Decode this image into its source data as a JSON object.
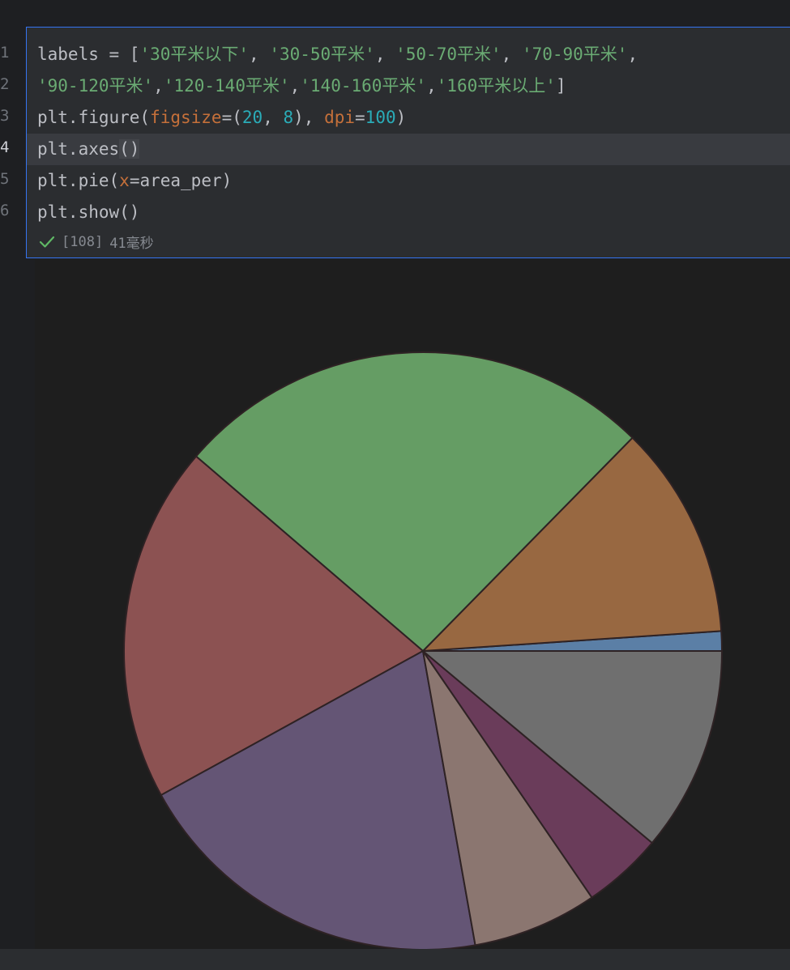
{
  "editor": {
    "line_numbers": [
      "1",
      "2",
      "3",
      "4",
      "5",
      "6"
    ],
    "active_line": 3,
    "code": {
      "l1": {
        "p1": "labels = [",
        "s1": "'30平米以下'",
        "c1": ", ",
        "s2": "'30-50平米'",
        "c2": ", ",
        "s3": "'50-70平米'",
        "c3": ", ",
        "s4": "'70-90平米'",
        "c4": ","
      },
      "l2": {
        "s1": "'90-120平米'",
        "c1": ",",
        "s2": "'120-140平米'",
        "c2": ",",
        "s3": "'140-160平米'",
        "c3": ",",
        "s4": "'160平米以上'",
        "end": "]"
      },
      "l3": {
        "p1": "plt.figure(",
        "k1": "figsize",
        "p2": "=(",
        "n1": "20",
        "p3": ", ",
        "n2": "8",
        "p4": "), ",
        "k2": "dpi",
        "p5": "=",
        "n3": "100",
        "p6": ")"
      },
      "l4": {
        "p1": "plt.axes",
        "p2": "()"
      },
      "l5": {
        "p1": "plt.pie(",
        "k1": "x",
        "p2": "=area_per)"
      },
      "l6": {
        "p1": "plt.show()"
      }
    },
    "execution": {
      "status_icon": "check-icon",
      "counter": "[108]",
      "duration": "41毫秒",
      "color": "#5fb865"
    },
    "colors": {
      "string": "#6aab73",
      "keyword_arg": "#c5703a",
      "number": "#2aacb8",
      "cell_border": "#3574f0"
    }
  },
  "chart_data": {
    "type": "pie",
    "start_angle": 0,
    "direction": "counterclockwise",
    "values": [
      1.1,
      12.0,
      27.0,
      20.0,
      20.5,
      7.0,
      4.5,
      11.5
    ],
    "colors": [
      "#5b7fa6",
      "#986841",
      "#659d64",
      "#8c5252",
      "#645575",
      "#8b7670",
      "#6a3c5a",
      "#6f6f6f"
    ],
    "edge_color": "#2e2224"
  }
}
